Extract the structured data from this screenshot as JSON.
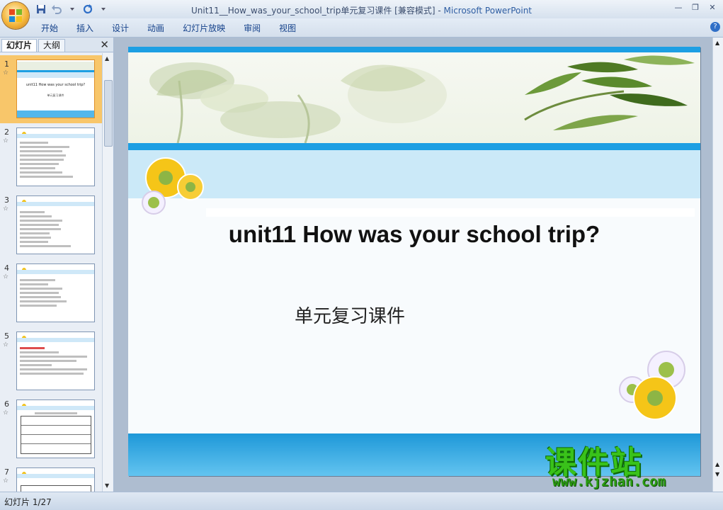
{
  "window": {
    "title_doc": "Unit11__How_was_your_school_trip单元复习课件 [兼容模式]",
    "title_sep": " - ",
    "title_app": "Microsoft PowerPoint"
  },
  "ribbon": {
    "tabs": [
      "开始",
      "插入",
      "设计",
      "动画",
      "幻灯片放映",
      "审阅",
      "视图"
    ]
  },
  "panel": {
    "tab_slides": "幻灯片",
    "tab_outline": "大纲",
    "thumbnails": [
      {
        "num": "1",
        "title": "unit11 How was your school trip?",
        "sub": "单元复习课件"
      },
      {
        "num": "2"
      },
      {
        "num": "3"
      },
      {
        "num": "4"
      },
      {
        "num": "5"
      },
      {
        "num": "6"
      },
      {
        "num": "7"
      }
    ]
  },
  "slide": {
    "title": "unit11 How was your school trip?",
    "subtitle": "单元复习课件"
  },
  "status": {
    "slide_counter": "幻灯片 1/27"
  },
  "watermark": {
    "big": "课件站",
    "url": "www.kjzhan.com"
  },
  "colors": {
    "accent_blue": "#1d9fe3",
    "selection": "#f8c66a",
    "watermark_green": "#39c21a"
  }
}
